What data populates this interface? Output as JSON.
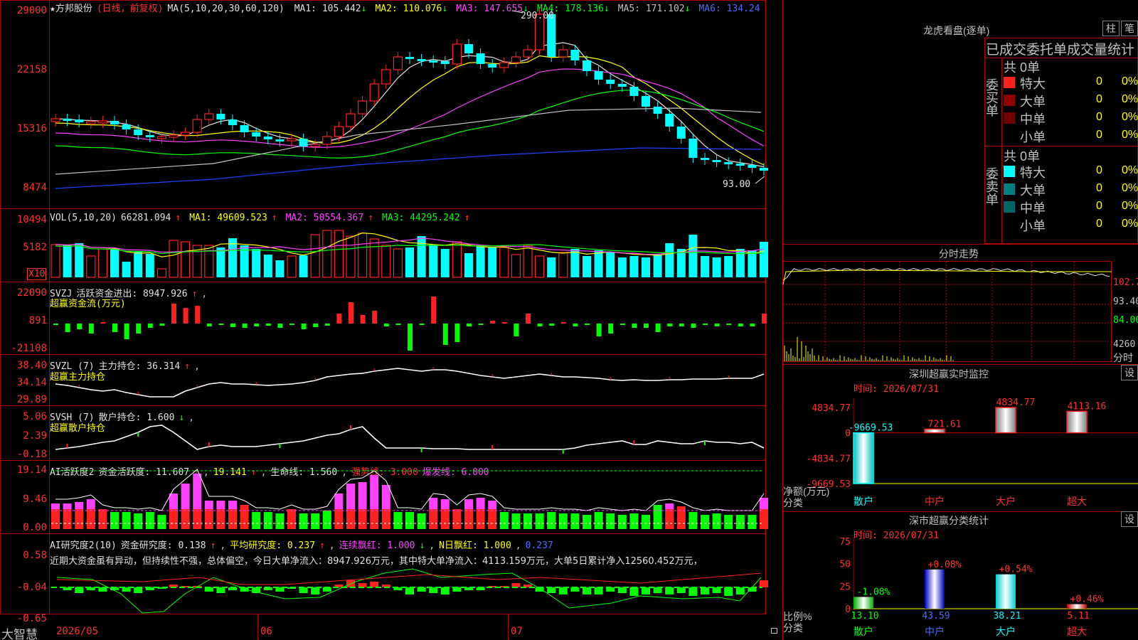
{
  "stock": {
    "name": "★方邦股份",
    "mode": "(日线，前复权)",
    "ma_header": "MA(5,10,20,30,60,120)",
    "ma": [
      {
        "label": "MA1: 105.442",
        "arrow": "↓",
        "color": "#e0e0e0"
      },
      {
        "label": "MA2: 110.076",
        "arrow": "↓",
        "color": "#ffff00"
      },
      {
        "label": "MA3: 147.655",
        "arrow": "↓",
        "color": "#ff40ff"
      },
      {
        "label": "MA4: 178.136",
        "arrow": "↓",
        "color": "#00ff00"
      },
      {
        "label": "MA5: 171.102",
        "arrow": "↓",
        "color": "#c0c0c0"
      },
      {
        "label": "MA6: 134.24",
        "arrow": "",
        "color": "#4a6cff"
      }
    ],
    "high_mark": "290.00",
    "low_mark": "93.00"
  },
  "price_axis": [
    "29000",
    "22158",
    "15316",
    "8474"
  ],
  "vol": {
    "title": "VOL(5,10,20)",
    "value": "66281.094",
    "ma1": "MA1: 49609.523",
    "ma2": "MA2: 50554.367",
    "ma3": "MA3: 44295.242",
    "axis": [
      "10494",
      "5182"
    ],
    "multiplier": "X10"
  },
  "svzj": {
    "title": "SVZJ",
    "label": "活跃资金进出: 8947.926",
    "subtitle": "超赢资金流(万元)",
    "axis": [
      "22090",
      "891",
      "-21108"
    ]
  },
  "svzl": {
    "title": "SVZL (7)",
    "label": "主力持仓: 36.314",
    "subtitle": "超赢主力持仓",
    "axis": [
      "38.40",
      "34.14",
      "29.89"
    ]
  },
  "svsh": {
    "title": "SVSH (7)",
    "label": "散户持仓: 1.600",
    "subtitle": "超赢散户持仓",
    "axis": [
      "5.06",
      "2.39",
      "-0.18"
    ]
  },
  "ai1": {
    "title": "AI活跃度2",
    "label": "资金活跃度: 11.607",
    "v2": "19.141",
    "life": "生命线: 1.560",
    "strong": "强势线: 3.000",
    "burst": "爆发线: 6.000",
    "axis": [
      "19.14",
      "9.46",
      "0.00"
    ]
  },
  "ai2": {
    "title": "AI研究度2(10)",
    "label": "资金研究度: 0.138",
    "avg": "平均研究度: 0.237",
    "cont": "连续飘红: 1.000",
    "nday": "N日飘红: 1.000",
    "last": "0.237",
    "comment": "近期大资金虽有异动，但持续性不强，总体偏空，今日大单净流入：8947.926万元，其中特大单净流入：4113.159万元，大单5日累计净入12560.452万元，",
    "axis": [
      "0.58",
      "-0.04",
      "-0.65"
    ]
  },
  "date_axis": [
    "2026/05",
    "06",
    "07"
  ],
  "brand": "大智慧",
  "right": {
    "lhb": {
      "title": "龙虎看盘(逐单)",
      "btn_bar": "柱",
      "btn_tick": "笔",
      "header": "已成交委托单成交量统计",
      "buy_label": "委买单",
      "sell_label": "委卖单",
      "buy_total": "共 0单",
      "sell_total": "共 0单",
      "rows": [
        {
          "name": "特大",
          "count": "0",
          "pct": "0%"
        },
        {
          "name": "大单",
          "count": "0",
          "pct": "0%"
        },
        {
          "name": "中单",
          "count": "0",
          "pct": "0%"
        },
        {
          "name": "小单",
          "count": "0",
          "pct": "0%"
        }
      ]
    },
    "intraday": {
      "title": "分时走势",
      "axis": [
        "102.7",
        "93.40",
        "84.06",
        "4260"
      ],
      "unit": "分时"
    },
    "monitor": {
      "title": "深圳超赢实时监控",
      "btn": "设",
      "time": "时间: 2026/07/31",
      "axis": [
        "4834.77",
        "0",
        "-4834.77",
        "-9669.53"
      ],
      "ylabel": "净额(万元)",
      "xlabel": "分类",
      "categories": [
        "散户",
        "中户",
        "大户",
        "超大"
      ],
      "values": [
        "-9669.53",
        "721.61",
        "4834.77",
        "4113.16"
      ]
    },
    "stats": {
      "title": "深市超赢分类统计",
      "btn": "设",
      "time": "时间: 2026/07/31",
      "axis": [
        "75",
        "50",
        "25",
        "0"
      ],
      "ylabel": "比例%",
      "xlabel": "分类",
      "categories": [
        "散户",
        "中户",
        "大户",
        "超大"
      ],
      "top_labels": [
        "-1.08%",
        "+0.08%",
        "+0.54%",
        "+0.46%"
      ],
      "values": [
        "13.10",
        "43.59",
        "38.21",
        "5.11"
      ]
    }
  },
  "chart_data": [
    {
      "type": "bar",
      "title": "深圳超赢实时监控",
      "categories": [
        "散户",
        "中户",
        "大户",
        "超大"
      ],
      "values": [
        -9669.53,
        721.61,
        4834.77,
        4113.16
      ],
      "ylabel": "净额(万元)",
      "xlabel": "分类",
      "ylim": [
        -9669.53,
        4834.77
      ]
    },
    {
      "type": "bar",
      "title": "深市超赢分类统计",
      "categories": [
        "散户",
        "中户",
        "大户",
        "超大"
      ],
      "values": [
        13.1,
        43.59,
        38.21,
        5.11
      ],
      "ylabel": "比例%",
      "xlabel": "分类",
      "ylim": [
        0,
        75
      ]
    }
  ],
  "colors": {
    "up": "#ff2020",
    "down": "#00ffff",
    "frame": "#b00000",
    "green": "#00ff00",
    "magenta": "#ff40ff"
  }
}
